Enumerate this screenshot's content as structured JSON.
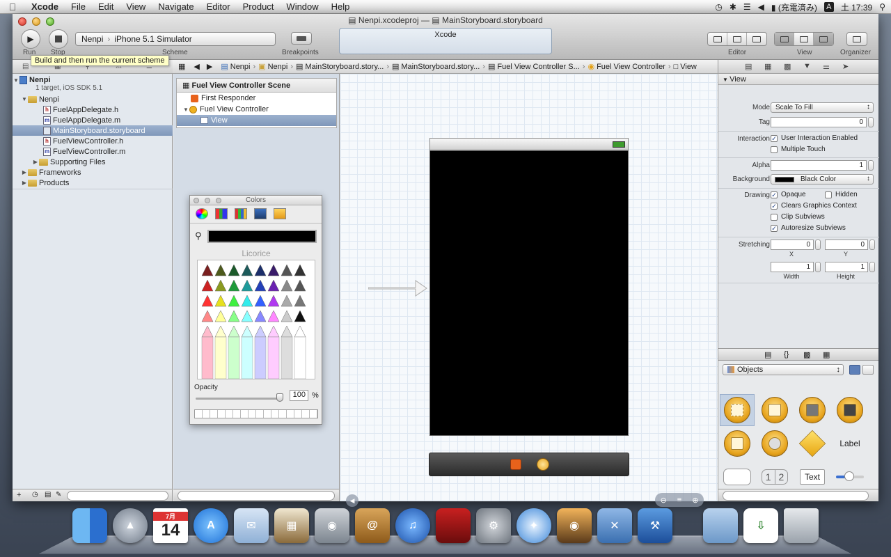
{
  "menubar": {
    "app": "Xcode",
    "items": [
      "File",
      "Edit",
      "View",
      "Navigate",
      "Editor",
      "Product",
      "Window",
      "Help"
    ],
    "status": {
      "charging": "(充電済み)",
      "input_method": "A",
      "clock": "土 17:39"
    }
  },
  "window": {
    "title_file1": "Nenpi.xcodeproj",
    "title_sep": "—",
    "title_file2": "MainStoryboard.storyboard"
  },
  "toolbar": {
    "run_label": "Run",
    "stop_label": "Stop",
    "scheme_label": "Scheme",
    "scheme_target": "Nenpi",
    "scheme_destination": "iPhone 5.1 Simulator",
    "breakpoints_label": "Breakpoints",
    "activity_text": "Xcode",
    "editor_label": "Editor",
    "view_label": "View",
    "organizer_label": "Organizer",
    "tooltip": "Build and then run the current scheme"
  },
  "navigator": {
    "project_name": "Nenpi",
    "project_sub": "1 target, iOS SDK 5.1",
    "group": "Nenpi",
    "files": [
      {
        "name": "FuelAppDelegate.h",
        "kind": "h"
      },
      {
        "name": "FuelAppDelegate.m",
        "kind": "m"
      },
      {
        "name": "MainStoryboard.storyboard",
        "kind": "sb"
      },
      {
        "name": "FuelViewController.h",
        "kind": "h"
      },
      {
        "name": "FuelViewController.m",
        "kind": "m"
      }
    ],
    "supporting": "Supporting Files",
    "frameworks": "Frameworks",
    "products": "Products"
  },
  "jumpbar": [
    "Nenpi",
    "Nenpi",
    "MainStoryboard.story...",
    "MainStoryboard.story...",
    "Fuel View Controller S...",
    "Fuel View Controller",
    "View"
  ],
  "outline": {
    "scene": "Fuel View Controller Scene",
    "first_responder": "First Responder",
    "controller": "Fuel View Controller",
    "view": "View"
  },
  "colors_panel": {
    "title": "Colors",
    "crayon_name": "Licorice",
    "opacity_label": "Opacity",
    "opacity_value": "100",
    "opacity_unit": "%"
  },
  "inspector": {
    "section": "View",
    "mode_label": "Mode",
    "mode_value": "Scale To Fill",
    "tag_label": "Tag",
    "tag_value": "0",
    "interaction_label": "Interaction",
    "user_interaction": "User Interaction Enabled",
    "multiple_touch": "Multiple Touch",
    "alpha_label": "Alpha",
    "alpha_value": "1",
    "background_label": "Background",
    "background_value": "Black Color",
    "drawing_label": "Drawing",
    "opaque": "Opaque",
    "hidden": "Hidden",
    "clears": "Clears Graphics Context",
    "clip": "Clip Subviews",
    "autoresize": "Autoresize Subviews",
    "stretching_label": "Stretching",
    "x_value": "0",
    "y_value": "0",
    "x_label": "X",
    "y_label": "Y",
    "width_value": "1",
    "height_value": "1",
    "width_label": "Width",
    "height_label": "Height"
  },
  "library": {
    "popup": "Objects",
    "label_item": "Label",
    "segment_1": "1",
    "segment_2": "2",
    "text_item": "Text"
  },
  "dock": {
    "calendar_month": "7月",
    "calendar_day": "14",
    "apps": [
      "finder-icon",
      "launchpad-icon",
      "calendar-icon",
      "app-store-icon",
      "mail-icon",
      "photo-icon",
      "facetime-icon",
      "address-book-icon",
      "itunes-icon",
      "photo-booth-icon",
      "system-preferences-icon",
      "safari-icon",
      "preview-icon",
      "xcode-icon",
      "instruments-icon",
      "folder-icon",
      "document-icon",
      "trash-icon"
    ]
  }
}
